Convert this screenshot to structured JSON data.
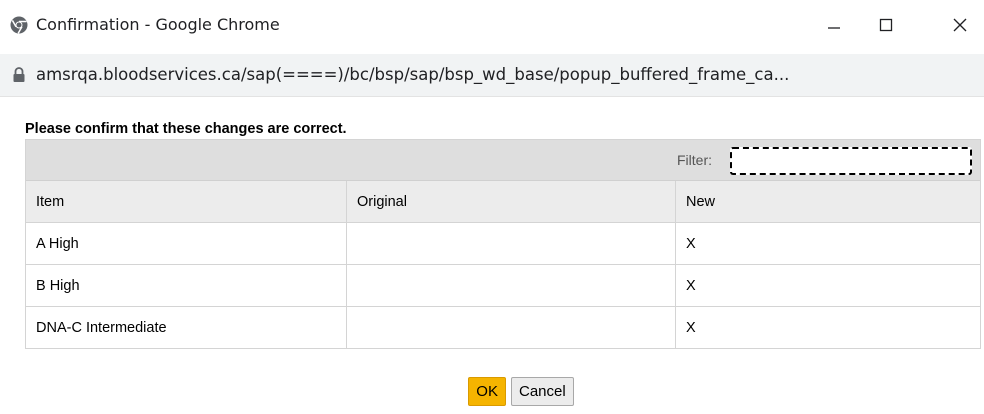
{
  "window": {
    "title": "Confirmation - Google Chrome",
    "url": "amsrqa.bloodservices.ca/sap(====)/bc/bsp/sap/bsp_wd_base/popup_buffered_frame_ca..."
  },
  "dialog": {
    "heading": "Please confirm that these changes are correct.",
    "filter_label": "Filter:",
    "filter_value": "",
    "columns": [
      "Item",
      "Original",
      "New"
    ],
    "rows": [
      {
        "item": "A High",
        "original": "",
        "new": "X"
      },
      {
        "item": "B High",
        "original": "",
        "new": "X"
      },
      {
        "item": "DNA-C Intermediate",
        "original": "",
        "new": "X"
      }
    ],
    "ok_label": "OK",
    "cancel_label": "Cancel"
  },
  "colors": {
    "ok_button": "#f5b400",
    "header_bg": "#dedede"
  }
}
